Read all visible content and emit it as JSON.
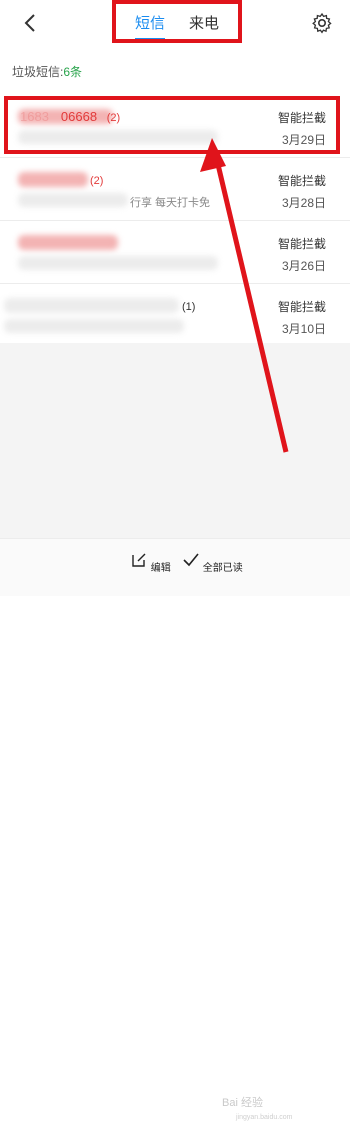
{
  "header": {
    "tabs": [
      {
        "label": "短信",
        "active": true
      },
      {
        "label": "来电",
        "active": false
      }
    ],
    "back_icon": "chevron-left-icon",
    "settings_icon": "gear-icon"
  },
  "summary": {
    "label": "垃圾短信:",
    "count": "6条"
  },
  "messages": [
    {
      "sender_prefix": "1683",
      "sender_suffix": "06668",
      "count": "(2)",
      "preview": "",
      "tag": "智能拦截",
      "date": "3月29日"
    },
    {
      "sender_prefix": "",
      "sender_suffix": "",
      "count": "(2)",
      "preview": "行享 每天打卡免",
      "tag": "智能拦截",
      "date": "3月28日"
    },
    {
      "sender_prefix": "",
      "sender_suffix": "",
      "count": "",
      "preview": "",
      "tag": "智能拦截",
      "date": "3月26日"
    },
    {
      "sender_prefix": "",
      "sender_suffix": "",
      "count": "(1)",
      "preview": "",
      "tag": "智能拦截",
      "date": "3月10日"
    }
  ],
  "bottom": {
    "edit_label": "编辑",
    "read_all_label": "全部已读"
  },
  "watermark": {
    "main": "Bai 经验",
    "sub": "jingyan.baidu.com"
  },
  "colors": {
    "accent": "#1a8cf0",
    "highlight": "#e0141b",
    "count_green": "#27a34a"
  }
}
